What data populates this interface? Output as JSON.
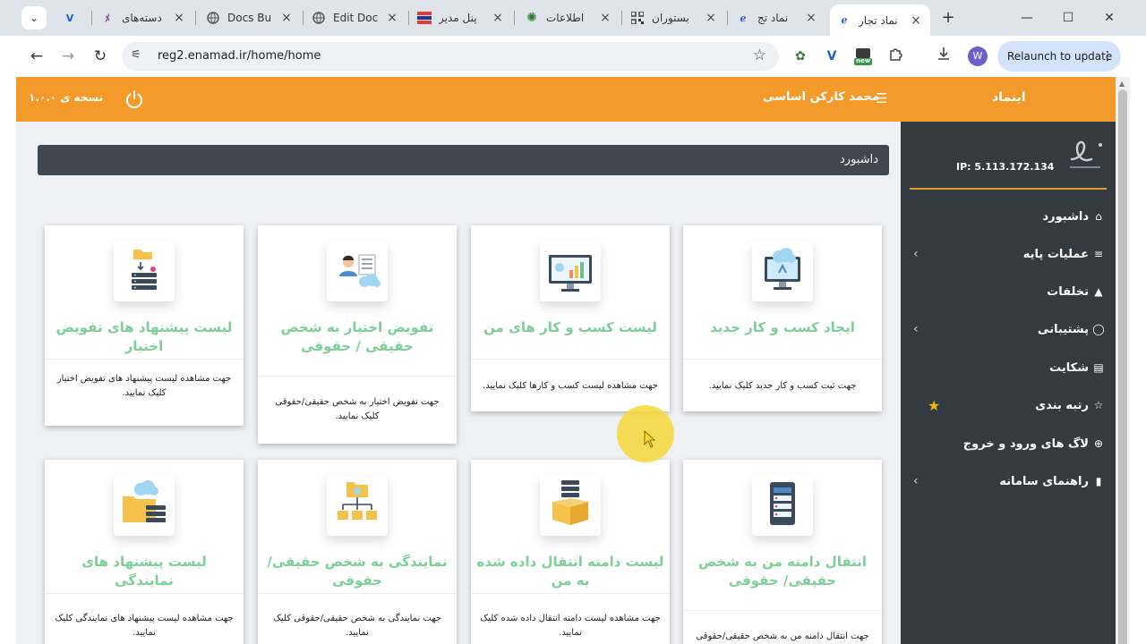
{
  "browser": {
    "tabs": [
      {
        "title": "",
        "favicon": "v-icon",
        "active": false
      },
      {
        "title": "دسته‌های",
        "favicon": "m-icon",
        "active": false
      },
      {
        "title": "Docs Bu",
        "favicon": "globe-icon",
        "active": false
      },
      {
        "title": "Edit Doc",
        "favicon": "globe-icon",
        "active": false
      },
      {
        "title": "پنل مدیر",
        "favicon": "stack-icon",
        "active": false
      },
      {
        "title": "اطلاعات",
        "favicon": "gear-icon",
        "active": false
      },
      {
        "title": "بستوران",
        "favicon": "qr-icon",
        "active": false
      },
      {
        "title": "نماد تج",
        "favicon": "enamad-icon",
        "active": false
      },
      {
        "title": "نماد تجار",
        "favicon": "enamad-icon",
        "active": true
      }
    ],
    "url": "reg2.enamad.ir/home/home",
    "relaunch_label": "Relaunch to update",
    "profile_initial": "W",
    "new_badge": "new"
  },
  "topbar": {
    "brand": "اینماد",
    "user": "محمد کارکن اساسی",
    "version": "نسخه ی ۱.۰.۰",
    "color": "#f39a2b"
  },
  "sidebar": {
    "ip": "IP: 5.113.172.134",
    "items": [
      {
        "label": "داشبورد",
        "icon": "home-icon",
        "has_children": false
      },
      {
        "label": "عملیات پایه",
        "icon": "list-icon",
        "has_children": true
      },
      {
        "label": "تخلفات",
        "icon": "warning-icon",
        "has_children": false
      },
      {
        "label": "پشتیبانی",
        "icon": "chat-icon",
        "has_children": true
      },
      {
        "label": "شکایت",
        "icon": "document-icon",
        "has_children": false
      },
      {
        "label": "رتبه بندی",
        "icon": "star-outline-icon",
        "has_children": false,
        "badge": "star-icon"
      },
      {
        "label": "لاگ های ورود و خروج",
        "icon": "plus-circle-icon",
        "has_children": false
      },
      {
        "label": "راهنمای سامانه",
        "icon": "file-icon",
        "has_children": true
      }
    ]
  },
  "dashboard": {
    "title": "داشبورد",
    "cards": [
      {
        "title": "ایجاد کسب و کار جدید",
        "desc": "جهت ثبت کسب و کار جدید کلیک نمایید.",
        "icon": "cloud-monitor-icon"
      },
      {
        "title": "لیست کسب و کار های من",
        "desc": "جهت مشاهده لیست کسب و کارها کلیک نمایید.",
        "icon": "analytics-monitor-icon"
      },
      {
        "title": "تفویض اختیار به شخص حقیقی / حقوقی",
        "desc": "جهت تفویض اختیار به شخص حقیقی/حقوقی کلیک نمایید.",
        "icon": "person-cloud-icon"
      },
      {
        "title": "لیست پیشنهاد های تفویض اختیار",
        "desc": "جهت مشاهده لیست پیشنهاد های تفویض اختیار کلیک نمایید.",
        "icon": "folder-server-icon"
      },
      {
        "title": "انتقال دامنه من به شخص حقیقی/ حقوقی",
        "desc": "جهت انتقال دامنه من به شخص حقیقی/حقوقی کلیک",
        "icon": "server-list-icon"
      },
      {
        "title": "لیست دامنه انتقال داده شده به من",
        "desc": "جهت مشاهده لیست دامنه انتقال داده شده کلیک نمایید.",
        "icon": "box-server-icon"
      },
      {
        "title": "نمایندگی به شخص حقیقی/حقوقی",
        "desc": "جهت نمایندگی به شخص حقیقی/حقوقی کلیک نمایید.",
        "icon": "folder-network-icon"
      },
      {
        "title": "لیست پیشنهاد های نمایندگی",
        "desc": "جهت مشاهده لیست پیشنهاد های نمایندگی کلیک نمایید.",
        "icon": "cloud-folder-icon"
      }
    ]
  }
}
